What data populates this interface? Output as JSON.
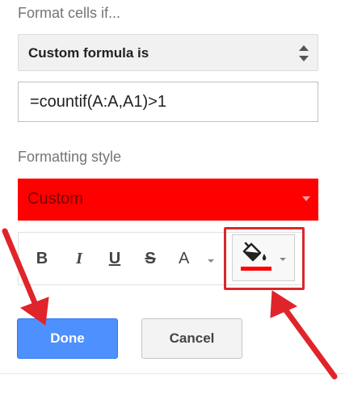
{
  "condition": {
    "section_label": "Format cells if...",
    "selected_rule": "Custom formula is",
    "formula_value": "=countif(A:A,A1)>1"
  },
  "formatting": {
    "section_label": "Formatting style",
    "style_value": "Custom",
    "style_color": "#ff0000",
    "fill_color": "#ff0000"
  },
  "toolbar": {
    "bold": "B",
    "italic": "I",
    "underline": "U",
    "strikethrough": "S",
    "text_color": "A",
    "icons": [
      "bold-icon",
      "italic-icon",
      "underline-icon",
      "strikethrough-icon",
      "text-color-icon",
      "fill-color-icon"
    ]
  },
  "actions": {
    "done_label": "Done",
    "cancel_label": "Cancel",
    "done_color": "#4d90fe"
  },
  "annotations": {
    "highlight_color": "#d9282c",
    "arrow_color": "#e0242b"
  }
}
